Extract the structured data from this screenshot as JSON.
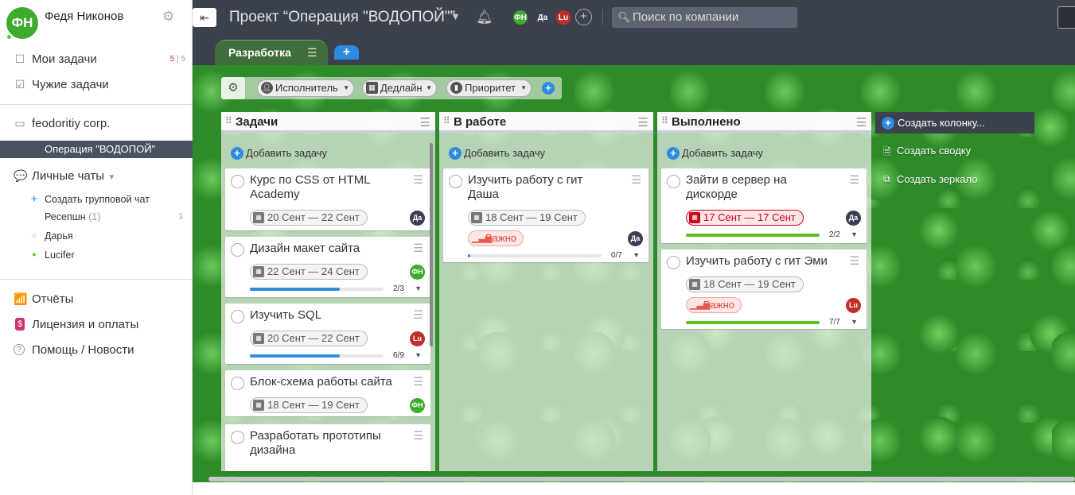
{
  "user": {
    "initials": "ФН",
    "name": "Федя Никонов"
  },
  "nav": {
    "my_tasks": "Мои задачи",
    "my_tasks_count_a": "5",
    "my_tasks_count_sep": "|",
    "my_tasks_count_b": "5",
    "others_tasks": "Чужие задачи",
    "company": "feodoritiy corp.",
    "active_project": "Операция \"ВОДОПОЙ\"",
    "personal_chats": "Личные чаты",
    "create_group_chat": "Создать групповой чат",
    "chats": [
      {
        "name": "Ресепшн",
        "badge": "(1)",
        "count": "1"
      },
      {
        "name": "Дарья"
      },
      {
        "name": "Lucifer"
      }
    ],
    "reports": "Отчёты",
    "license": "Лицензия и оплаты",
    "help": "Помощь / Новости"
  },
  "topbar": {
    "project_title": "Проект “Операция \"ВОДОПОЙ\"”",
    "members": [
      {
        "initials": "ФН",
        "color": "#3cab2e"
      },
      {
        "initials": "Да",
        "color": "#3b3f56"
      },
      {
        "initials": "Lu",
        "color": "#c0302a"
      }
    ],
    "search_placeholder": "Поиск по компании"
  },
  "tabs": [
    {
      "label": "Разработка"
    }
  ],
  "filters": [
    {
      "label": "Исполнитель"
    },
    {
      "label": "Дедлайн"
    },
    {
      "label": "Приоритет"
    }
  ],
  "columns": [
    {
      "title": "Задачи",
      "add_label": "Добавить задачу",
      "cards": [
        {
          "title": "Курс по CSS от HTML Academy",
          "date": "20 Сент — 22 Сент",
          "assignee": "Да",
          "assignee_color": "#3b3f56"
        },
        {
          "title": "Дизайн макет сайта",
          "date": "22 Сент — 24 Сент",
          "assignee": "ФН",
          "assignee_color": "#3cab2e",
          "progress": "2/3",
          "progress_value": 0.67,
          "bar_color": "#2d8ce0"
        },
        {
          "title": "Изучить SQL",
          "date": "20 Сент — 22 Сент",
          "assignee": "Lu",
          "assignee_color": "#c0302a",
          "progress": "6/9",
          "progress_value": 0.67,
          "bar_color": "#2d8ce0"
        },
        {
          "title": "Блок-схема работы сайта",
          "date": "18 Сент — 19 Сент",
          "assignee": "ФН",
          "assignee_color": "#3cab2e"
        },
        {
          "title": "Разработать прототипы дизайна"
        }
      ]
    },
    {
      "title": "В работе",
      "add_label": "Добавить задачу",
      "cards": [
        {
          "title": "Изучить работу с гит Даша",
          "date": "18 Сент — 19 Сент",
          "priority": "Важно",
          "assignee": "Да",
          "assignee_color": "#3b3f56",
          "progress": "0/7",
          "progress_value": 0.02,
          "bar_color": "#2d8ce0"
        }
      ]
    },
    {
      "title": "Выполнено",
      "add_label": "Добавить задачу",
      "cards": [
        {
          "title": "Зайти в сервер на дискорде",
          "date": "17 Сент — 17 Сент",
          "overdue": true,
          "assignee": "Да",
          "assignee_color": "#3b3f56",
          "progress": "2/2",
          "progress_value": 1,
          "bar_color": "#5cc11f"
        },
        {
          "title": "Изучить работу с гит Эми",
          "date": "18 Сент — 19 Сент",
          "priority": "Важно",
          "assignee": "Lu",
          "assignee_color": "#c0302a",
          "progress": "7/7",
          "progress_value": 1,
          "bar_color": "#5cc11f"
        }
      ]
    }
  ],
  "side_actions": {
    "create_column": "Создать колонку...",
    "create_summary": "Создать сводку",
    "create_mirror": "Создать зеркало"
  }
}
